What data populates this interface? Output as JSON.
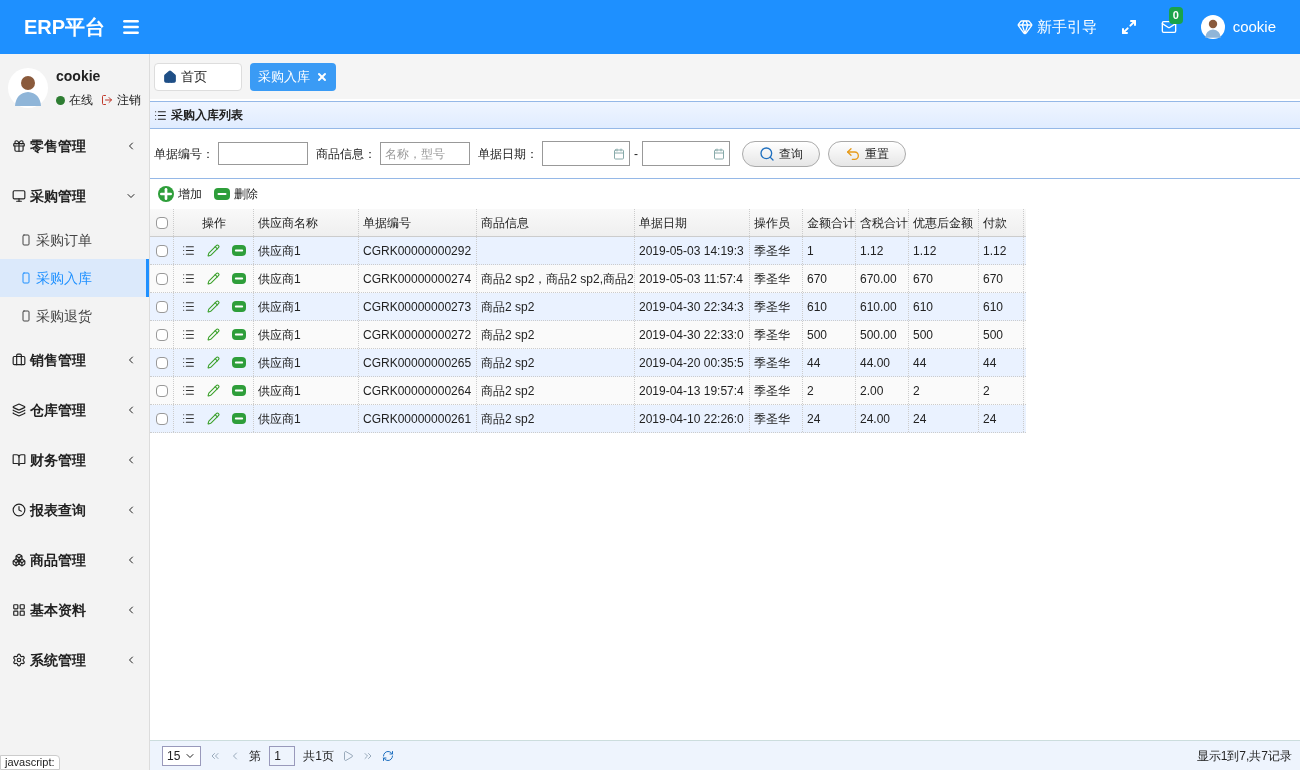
{
  "header": {
    "logo": "ERP平台",
    "guide": "新手引导",
    "mail_count": "0",
    "user": "cookie"
  },
  "profile": {
    "name": "cookie",
    "status": "在线",
    "logout": "注销"
  },
  "sidebar": {
    "items": [
      {
        "label": "零售管理",
        "expanded": false
      },
      {
        "label": "采购管理",
        "expanded": true,
        "children": [
          {
            "label": "采购订单",
            "selected": false
          },
          {
            "label": "采购入库",
            "selected": true
          },
          {
            "label": "采购退货",
            "selected": false
          }
        ]
      },
      {
        "label": "销售管理",
        "expanded": false
      },
      {
        "label": "仓库管理",
        "expanded": false
      },
      {
        "label": "财务管理",
        "expanded": false
      },
      {
        "label": "报表查询",
        "expanded": false
      },
      {
        "label": "商品管理",
        "expanded": false
      },
      {
        "label": "基本资料",
        "expanded": false
      },
      {
        "label": "系统管理",
        "expanded": false
      }
    ]
  },
  "tabs": [
    {
      "label": "首页",
      "kind": "home",
      "selected": false
    },
    {
      "label": "采购入库",
      "kind": "closable",
      "selected": true
    }
  ],
  "panel_title": "采购入库列表",
  "search": {
    "number_label": "单据编号：",
    "goods_label": "商品信息：",
    "goods_placeholder": "名称，型号",
    "date_label": "单据日期：",
    "date_separator": "-",
    "query": "查询",
    "reset": "重置"
  },
  "toolbar": {
    "add": "增加",
    "delete": "删除"
  },
  "table": {
    "all_checked": false,
    "actions_header": "操作",
    "columns": [
      "供应商名称",
      "单据编号",
      "商品信息",
      "单据日期",
      "操作员",
      "金额合计",
      "含税合计",
      "优惠后金额",
      "付款"
    ],
    "rows": [
      {
        "checked": false,
        "cells": [
          "供应商1",
          "CGRK00000000292",
          "",
          "2019-05-03 14:19:3",
          "季圣华",
          "1",
          "1.12",
          "1.12",
          "1.12"
        ]
      },
      {
        "checked": false,
        "cells": [
          "供应商1",
          "CGRK00000000274",
          "商品2 sp2，商品2 sp2,商品2",
          "2019-05-03 11:57:4",
          "季圣华",
          "670",
          "670.00",
          "670",
          "670"
        ]
      },
      {
        "checked": false,
        "cells": [
          "供应商1",
          "CGRK00000000273",
          "商品2 sp2",
          "2019-04-30 22:34:3",
          "季圣华",
          "610",
          "610.00",
          "610",
          "610"
        ]
      },
      {
        "checked": false,
        "cells": [
          "供应商1",
          "CGRK00000000272",
          "商品2 sp2",
          "2019-04-30 22:33:0",
          "季圣华",
          "500",
          "500.00",
          "500",
          "500"
        ]
      },
      {
        "checked": false,
        "cells": [
          "供应商1",
          "CGRK00000000265",
          "商品2 sp2",
          "2019-04-20 00:35:5",
          "季圣华",
          "44",
          "44.00",
          "44",
          "44"
        ]
      },
      {
        "checked": false,
        "cells": [
          "供应商1",
          "CGRK00000000264",
          "商品2 sp2",
          "2019-04-13 19:57:4",
          "季圣华",
          "2",
          "2.00",
          "2",
          "2"
        ]
      },
      {
        "checked": false,
        "cells": [
          "供应商1",
          "CGRK00000000261",
          "商品2 sp2",
          "2019-04-10 22:26:0",
          "季圣华",
          "24",
          "24.00",
          "24",
          "24"
        ]
      }
    ]
  },
  "pager": {
    "page_size": "15",
    "page_prefix": "第",
    "page": "1",
    "page_suffix": "共1页",
    "summary": "显示1到7,共7记录"
  },
  "browser_status": "javascript:"
}
